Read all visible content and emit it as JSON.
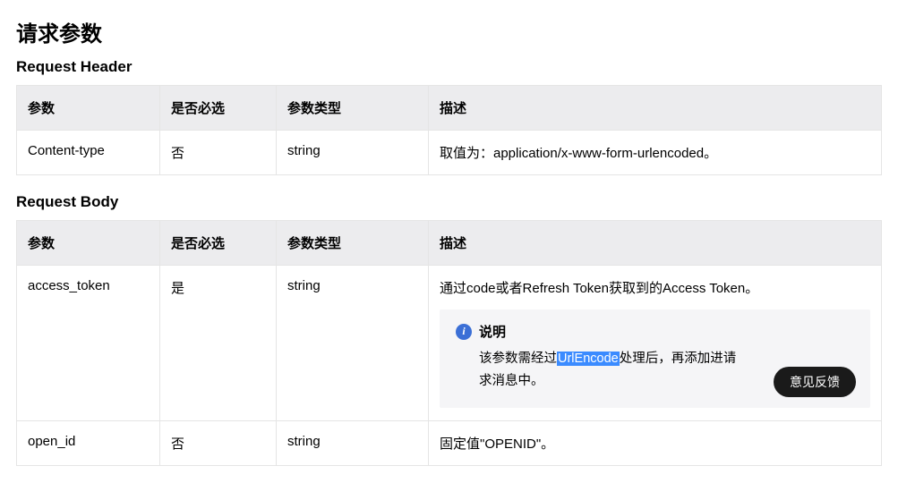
{
  "pageTitle": "请求参数",
  "sections": {
    "header": {
      "title": "Request Header",
      "columns": [
        "参数",
        "是否必选",
        "参数类型",
        "描述"
      ],
      "rows": [
        {
          "param": "Content-type",
          "required": "否",
          "type": "string",
          "desc": "取值为：application/x-www-form-urlencoded。"
        }
      ]
    },
    "body": {
      "title": "Request Body",
      "columns": [
        "参数",
        "是否必选",
        "参数类型",
        "描述"
      ],
      "rows": [
        {
          "param": "access_token",
          "required": "是",
          "type": "string",
          "desc": "通过code或者Refresh Token获取到的Access Token。",
          "note": {
            "label": "说明",
            "textBefore": "该参数需经过",
            "highlight": "UrlEncode",
            "textAfter": "处理后，再添加进请求消息中。"
          }
        },
        {
          "param": "open_id",
          "required": "否",
          "type": "string",
          "desc": "固定值\"OPENID\"。"
        }
      ]
    }
  },
  "feedbackLabel": "意见反馈",
  "infoGlyph": "i"
}
